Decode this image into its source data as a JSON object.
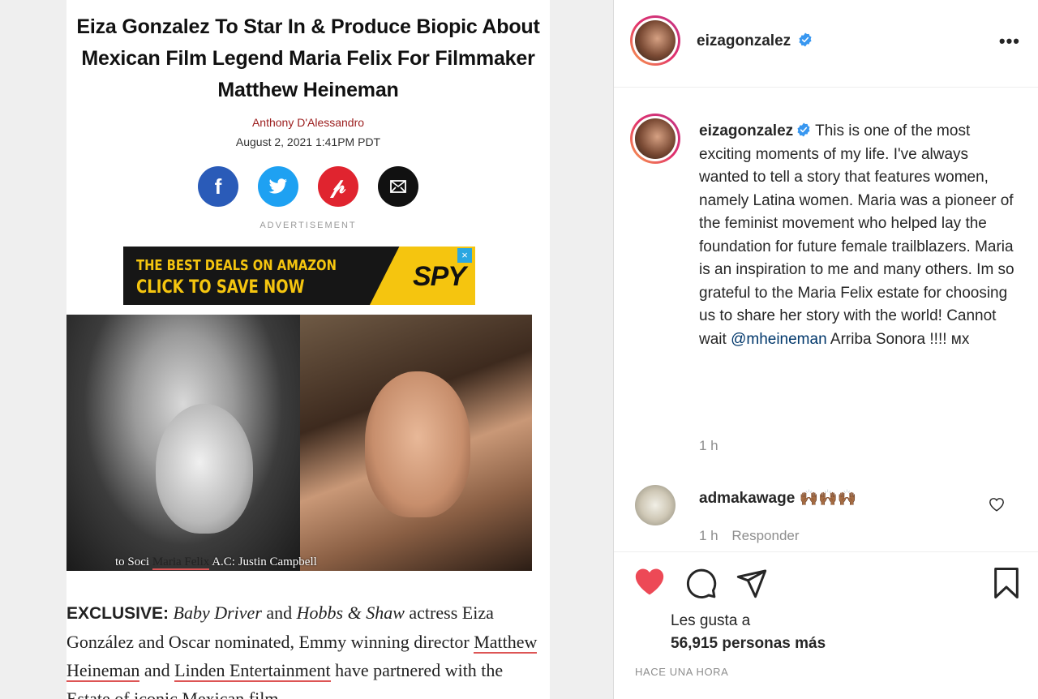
{
  "article": {
    "title": "Eiza Gonzalez To Star In & Produce Biopic About Mexican Film Legend Maria Felix For Filmmaker Matthew Heineman",
    "author": "Anthony D'Alessandro",
    "date": "August 2, 2021 1:41PM PDT",
    "share_icons": [
      "facebook-icon",
      "twitter-icon",
      "pinterest-icon",
      "mail-icon"
    ],
    "ad_label": "ADVERTISEMENT",
    "ad_line1": "THE BEST DEALS ON AMAZON",
    "ad_line2": "CLICK TO SAVE NOW",
    "ad_brand": "SPY",
    "ad_close": "×",
    "caption_left": "to Soci",
    "caption_name": "Maria Felix",
    "caption_right": "A.C: Justin Campbell",
    "body_lead": "EXCLUSIVE:",
    "body_film1": "Baby Driver",
    "body_and": "and",
    "body_film2": "Hobbs & Shaw",
    "body_text1": "actress Eiza González and Oscar nominated, Emmy winning director",
    "body_link1": "Matthew Heineman",
    "body_and2": "and",
    "body_link2": "Linden Entertainment",
    "body_text2": "have partnered with the Estate of iconic Mexican film"
  },
  "header": {
    "username": "eizagonzalez",
    "more": "•••"
  },
  "caption": {
    "username": "eizagonzalez",
    "text": "This is one of the most exciting moments of my life. I've always wanted to tell a story that features women, namely Latina women. Maria was a pioneer of the feminist movement who helped lay the foundation for future female trailblazers. Maria is an inspiration to me and many others. Im so grateful to the Maria Felix estate for choosing us to share her story with the world! Cannot wait",
    "mention": "@mheineman",
    "text_end": "Arriba Sonora !!!! мх",
    "time": "1 h"
  },
  "comment": {
    "username": "admakawage",
    "emojis": "🙌🏾🙌🏾🙌🏾",
    "time": "1 h",
    "reply": "Responder"
  },
  "likes": {
    "label": "Les gusta a",
    "count": "56,915 personas más"
  },
  "timestamp": "HACE UNA HORA",
  "colors": {
    "like_red": "#ed4956",
    "verified_blue": "#3897f0",
    "mention_blue": "#00376b"
  }
}
